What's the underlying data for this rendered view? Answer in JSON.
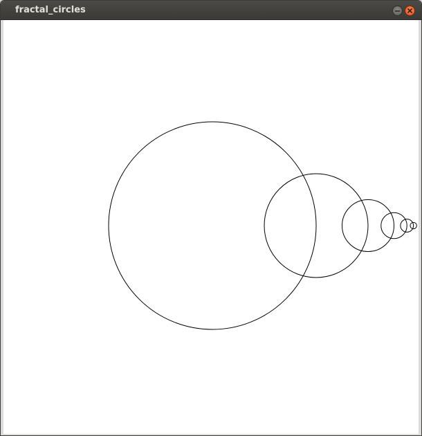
{
  "window": {
    "title": "fractal_circles",
    "minimize_icon": "minimize-icon",
    "close_icon": "close-icon"
  },
  "colors": {
    "titlebar": "#3c3b37",
    "title_text": "#e2e0d8",
    "close_button": "#e95420",
    "canvas_background": "#ffffff",
    "stroke": "#000000"
  },
  "canvas": {
    "shape": "circle",
    "circle_count": 6,
    "radius_ratio": 0.5
  }
}
